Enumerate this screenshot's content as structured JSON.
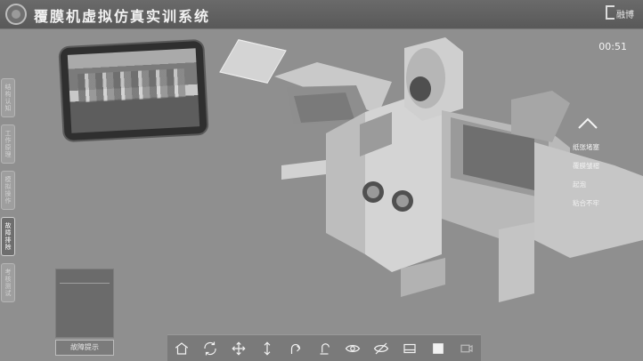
{
  "header": {
    "title": "覆膜机虚拟仿真实训系统",
    "brand": "融博"
  },
  "timer": "00:51",
  "sidebar": {
    "items": [
      {
        "label": "结构认知",
        "active": false
      },
      {
        "label": "工作原理",
        "active": false
      },
      {
        "label": "模拟操作",
        "active": false
      },
      {
        "label": "故障排除",
        "active": true
      },
      {
        "label": "考核测试",
        "active": false
      }
    ]
  },
  "hint_panel": {
    "button_label": "故障提示"
  },
  "context_menu": {
    "items": [
      "纸张堵塞",
      "覆膜皱褶",
      "起泡",
      "粘合不牢"
    ]
  },
  "toolbar": {
    "icons": [
      "home-icon",
      "rotate-icon",
      "move-icon",
      "vertical-move-icon",
      "undo-icon",
      "reset-icon",
      "show-icon",
      "hide-icon",
      "view-front-icon",
      "view-top-icon",
      "view-side-icon"
    ]
  },
  "colors": {
    "background": "#8f8f8f",
    "topbar": "#5f5f5f",
    "accent": "#ffffff"
  }
}
